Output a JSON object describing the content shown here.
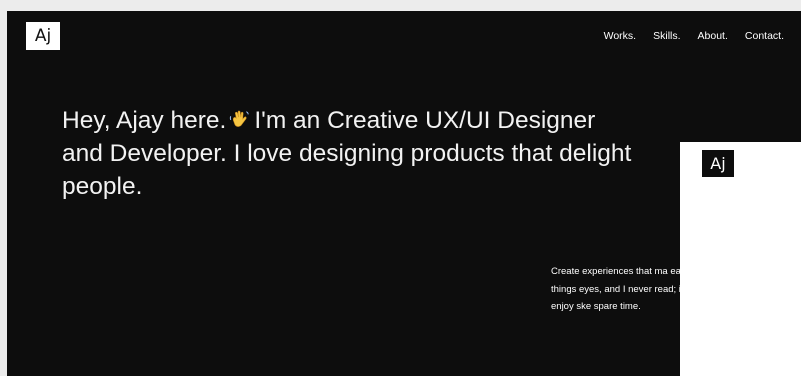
{
  "header": {
    "logo": "Aj",
    "nav": [
      "Works.",
      "Skills.",
      "About.",
      "Contact."
    ]
  },
  "hero": {
    "line_part1": "Hey, Ajay here.",
    "emoji_icon": "waving-hand-icon",
    "line_part2": "I'm an Creative UX/UI Designer and Developer. I love designing products that delight people."
  },
  "intro": {
    "text": "Create experiences that ma easier. I see ordinary things eyes, and I never read; inste pictures. I usually enjoy ske spare time."
  },
  "overlay": {
    "logo": "Aj"
  },
  "colors": {
    "background": "#0d0d0d",
    "text": "#ffffff",
    "logo_bg": "#ffffff",
    "wave": "#f5c542"
  }
}
